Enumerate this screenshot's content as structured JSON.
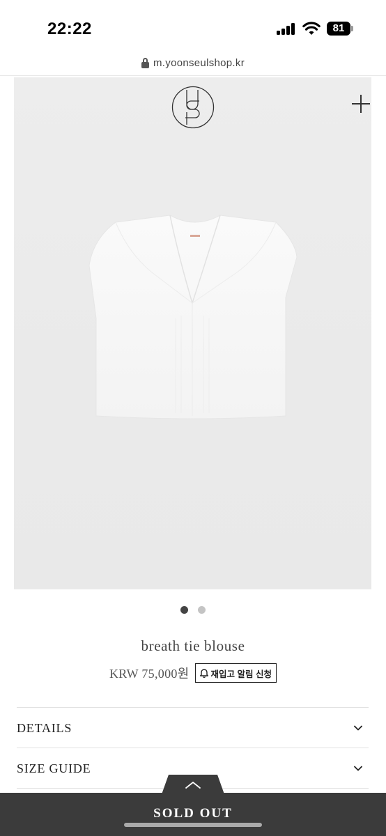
{
  "status_bar": {
    "time": "22:22",
    "battery": "81",
    "icons": [
      "cellular-signal-icon",
      "wifi-icon",
      "battery-icon"
    ]
  },
  "browser": {
    "url": "m.yoonseulshop.kr",
    "icons": [
      "lock-icon"
    ]
  },
  "product": {
    "image_icons": [
      "brand-logo-icon",
      "plus-icon"
    ],
    "carousel": {
      "count": 2,
      "active_index": 0
    },
    "name": "breath tie blouse",
    "price": "KRW 75,000원",
    "restock_button_label": "재입고 알림 신청",
    "restock_icon": "bell-icon"
  },
  "accordion": {
    "items": [
      {
        "label": "DETAILS",
        "icon": "chevron-down-icon"
      },
      {
        "label": "SIZE GUIDE",
        "icon": "chevron-down-icon"
      }
    ]
  },
  "footer": {
    "expand_icon": "chevron-up-icon",
    "sold_out_label": "SOLD OUT"
  },
  "colors": {
    "footer_bar": "#3b3b3b",
    "active_dot": "#444444",
    "inactive_dot": "#c4c4c4"
  }
}
